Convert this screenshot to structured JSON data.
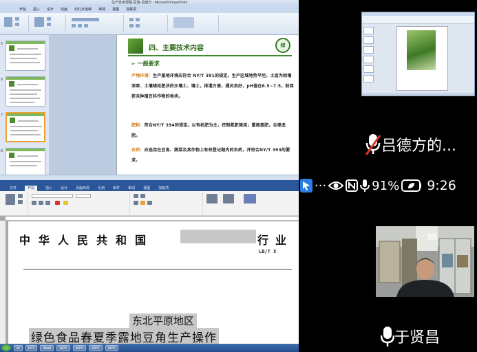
{
  "shared_screen": {
    "powerpoint": {
      "window_title": "生产技术规程-豆角-吕德方 - Microsoft PowerPoint",
      "tabs": [
        "开始",
        "插入",
        "设计",
        "动画",
        "幻灯片放映",
        "审阅",
        "视图",
        "加载项"
      ],
      "slide_numbers": [
        "5",
        "6",
        "7",
        "8"
      ],
      "slide": {
        "title": "四、主要技术内容",
        "logo_text": "绿",
        "subtitle": "一般要求",
        "para1_label": "产地环境：",
        "para1_text": "生产基地环境应符合 NY/T 391的规定。生产区域地势平坦，土层为棕壤深厚、土壤疏松肥沃的沙壤土、壤土，排灌方便，通风良好，pH值在6.5~7.5，前两茬未种植豆科作物的地块。",
        "para2_label": "肥料：",
        "para2_text": "符合NY/T 394的规定。以有机肥为主，控制氮肥施用；重施基肥，合理追肥。",
        "para3_label": "农药：",
        "para3_text": "应选用在豆角、蔬菜及其作物上有效登记期内的农药，并符合NY/T 393的要求。"
      }
    },
    "word": {
      "tabs": [
        "文件",
        "开始",
        "插入",
        "设计",
        "页面布局",
        "引用",
        "邮件",
        "审阅",
        "视图",
        "加载项"
      ],
      "active_tab": "开始",
      "doc_title_left": "中华人民共和国",
      "doc_title_right": "行业",
      "standard_no": "LB/T X",
      "region": "东北平原地区",
      "doc_name": "绿色食品春夏季露地豆角生产操作"
    },
    "taskbar": {
      "items": [
        "W",
        "PPT",
        "Word",
        "WPS",
        "WPS",
        "WPS",
        "WPS"
      ]
    }
  },
  "participants": [
    {
      "name": "吕德方的...",
      "muted": true
    },
    {
      "name": "于贤昌",
      "muted": false
    }
  ],
  "status_bar": {
    "notifications": "···",
    "battery": "91%",
    "time": "9:26"
  },
  "colors": {
    "slide_green": "#2f6a1a",
    "keyword_orange": "#d07a12",
    "mute_red": "#e0302a",
    "word_blue": "#2b579a"
  }
}
